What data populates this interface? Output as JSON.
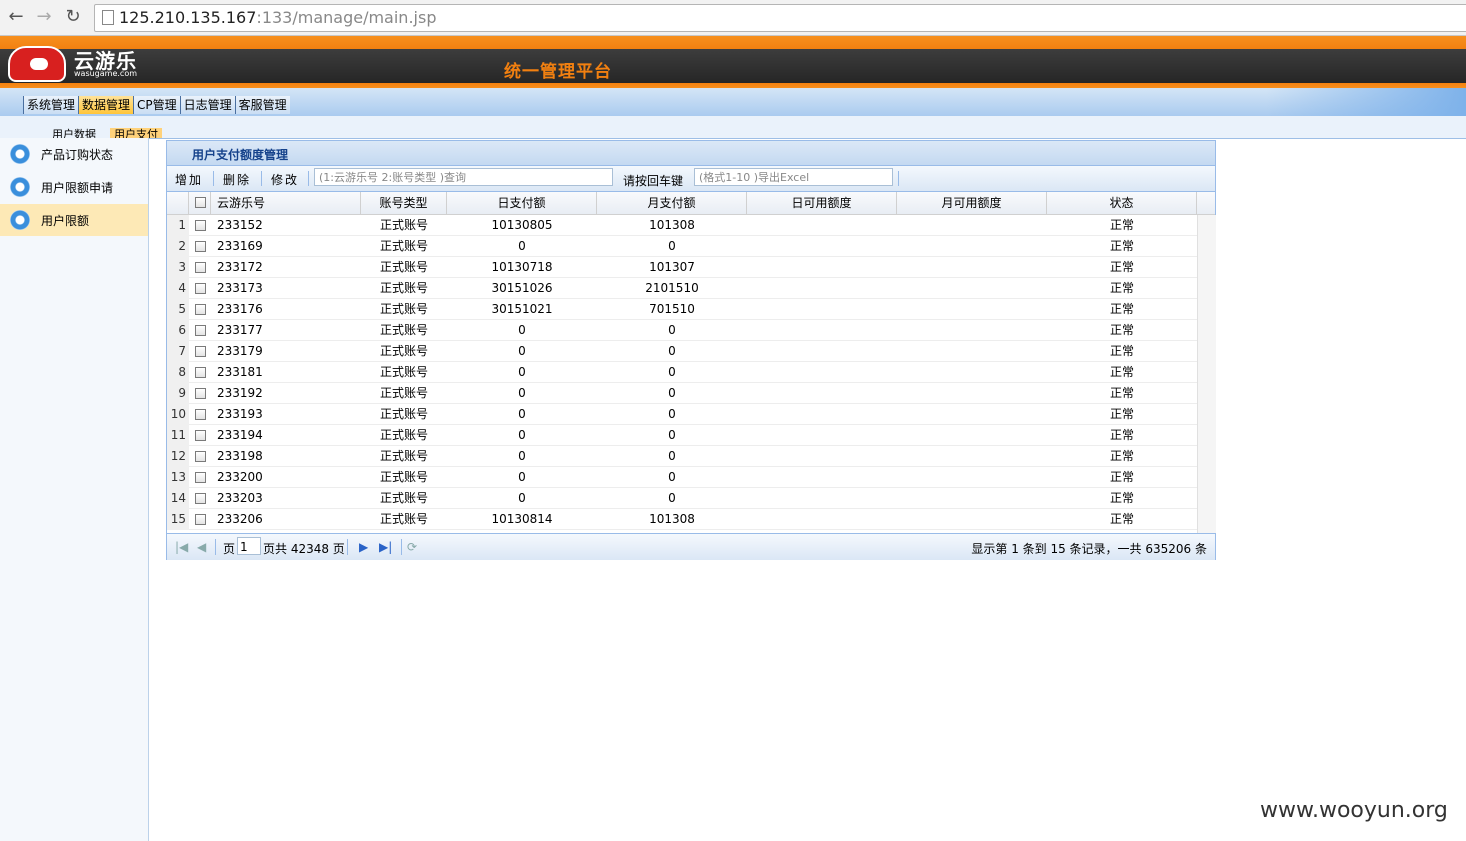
{
  "browser": {
    "url_host": "125.210.135.167",
    "url_rest": ":133/manage/main.jsp"
  },
  "header": {
    "logo_text": "云游乐",
    "logo_sub": "wasugame.com",
    "platform_title": "统一管理平台"
  },
  "menu": {
    "items": [
      {
        "label": "系统管理"
      },
      {
        "label": "数据管理"
      },
      {
        "label": "CP管理"
      },
      {
        "label": "日志管理"
      },
      {
        "label": "客服管理"
      }
    ]
  },
  "subtabs": [
    "用户数据",
    "用户支付"
  ],
  "sidebar": {
    "items": [
      {
        "label": "产品订购状态"
      },
      {
        "label": "用户限额申请"
      },
      {
        "label": "用户限额"
      }
    ]
  },
  "panel": {
    "title": "用户支付额度管理"
  },
  "toolbar": {
    "add_label": "增加",
    "delete_label": "删除",
    "edit_label": "修改",
    "search_placeholder": "(1:云游乐号 2:账号类型 )查询",
    "enter_hint": "请按回车键",
    "export_placeholder": "(格式1-10 )导出Excel"
  },
  "grid": {
    "columns": [
      "云游乐号",
      "账号类型",
      "日支付额",
      "月支付额",
      "日可用额度",
      "月可用额度",
      "状态"
    ],
    "rows": [
      {
        "num": "1",
        "id": "233152",
        "type": "正式账号",
        "daily": "10130805",
        "monthly": "101308",
        "daily_avail": "",
        "monthly_avail": "",
        "status": "正常"
      },
      {
        "num": "2",
        "id": "233169",
        "type": "正式账号",
        "daily": "0",
        "monthly": "0",
        "daily_avail": "",
        "monthly_avail": "",
        "status": "正常"
      },
      {
        "num": "3",
        "id": "233172",
        "type": "正式账号",
        "daily": "10130718",
        "monthly": "101307",
        "daily_avail": "",
        "monthly_avail": "",
        "status": "正常"
      },
      {
        "num": "4",
        "id": "233173",
        "type": "正式账号",
        "daily": "30151026",
        "monthly": "2101510",
        "daily_avail": "",
        "monthly_avail": "",
        "status": "正常"
      },
      {
        "num": "5",
        "id": "233176",
        "type": "正式账号",
        "daily": "30151021",
        "monthly": "701510",
        "daily_avail": "",
        "monthly_avail": "",
        "status": "正常"
      },
      {
        "num": "6",
        "id": "233177",
        "type": "正式账号",
        "daily": "0",
        "monthly": "0",
        "daily_avail": "",
        "monthly_avail": "",
        "status": "正常"
      },
      {
        "num": "7",
        "id": "233179",
        "type": "正式账号",
        "daily": "0",
        "monthly": "0",
        "daily_avail": "",
        "monthly_avail": "",
        "status": "正常"
      },
      {
        "num": "8",
        "id": "233181",
        "type": "正式账号",
        "daily": "0",
        "monthly": "0",
        "daily_avail": "",
        "monthly_avail": "",
        "status": "正常"
      },
      {
        "num": "9",
        "id": "233192",
        "type": "正式账号",
        "daily": "0",
        "monthly": "0",
        "daily_avail": "",
        "monthly_avail": "",
        "status": "正常"
      },
      {
        "num": "10",
        "id": "233193",
        "type": "正式账号",
        "daily": "0",
        "monthly": "0",
        "daily_avail": "",
        "monthly_avail": "",
        "status": "正常"
      },
      {
        "num": "11",
        "id": "233194",
        "type": "正式账号",
        "daily": "0",
        "monthly": "0",
        "daily_avail": "",
        "monthly_avail": "",
        "status": "正常"
      },
      {
        "num": "12",
        "id": "233198",
        "type": "正式账号",
        "daily": "0",
        "monthly": "0",
        "daily_avail": "",
        "monthly_avail": "",
        "status": "正常"
      },
      {
        "num": "13",
        "id": "233200",
        "type": "正式账号",
        "daily": "0",
        "monthly": "0",
        "daily_avail": "",
        "monthly_avail": "",
        "status": "正常"
      },
      {
        "num": "14",
        "id": "233203",
        "type": "正式账号",
        "daily": "0",
        "monthly": "0",
        "daily_avail": "",
        "monthly_avail": "",
        "status": "正常"
      },
      {
        "num": "15",
        "id": "233206",
        "type": "正式账号",
        "daily": "10130814",
        "monthly": "101308",
        "daily_avail": "",
        "monthly_avail": "",
        "status": "正常"
      }
    ]
  },
  "pager": {
    "page_label": "页",
    "page_value": "1",
    "page_total": "页共 42348 页",
    "summary": "显示第 1 条到 15 条记录，一共 635206 条"
  },
  "watermark": "www.wooyun.org"
}
